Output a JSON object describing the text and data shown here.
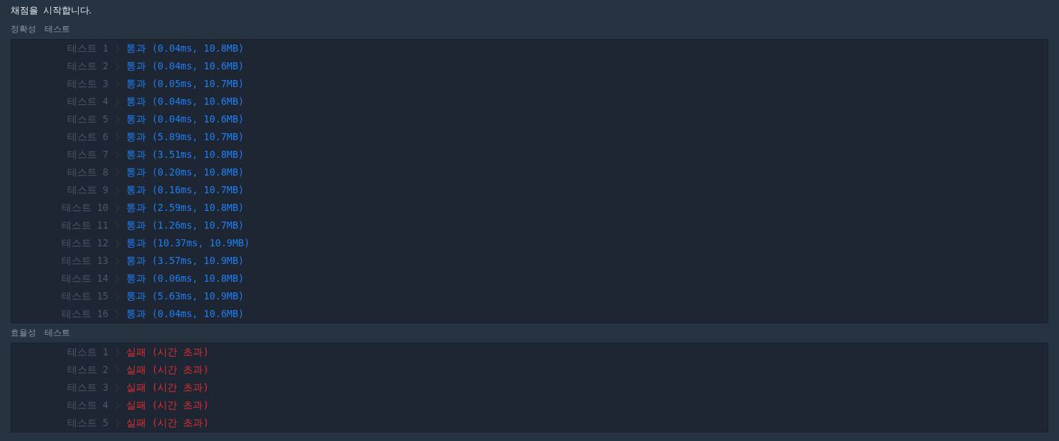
{
  "message": "채점을 시작합니다.",
  "sections": [
    {
      "title": "정확성 테스트",
      "rows": [
        {
          "label": "테스트 1",
          "kind": "pass",
          "result": "통과 (0.04ms, 10.8MB)"
        },
        {
          "label": "테스트 2",
          "kind": "pass",
          "result": "통과 (0.04ms, 10.6MB)"
        },
        {
          "label": "테스트 3",
          "kind": "pass",
          "result": "통과 (0.05ms, 10.7MB)"
        },
        {
          "label": "테스트 4",
          "kind": "pass",
          "result": "통과 (0.04ms, 10.6MB)"
        },
        {
          "label": "테스트 5",
          "kind": "pass",
          "result": "통과 (0.04ms, 10.6MB)"
        },
        {
          "label": "테스트 6",
          "kind": "pass",
          "result": "통과 (5.89ms, 10.7MB)"
        },
        {
          "label": "테스트 7",
          "kind": "pass",
          "result": "통과 (3.51ms, 10.8MB)"
        },
        {
          "label": "테스트 8",
          "kind": "pass",
          "result": "통과 (0.20ms, 10.8MB)"
        },
        {
          "label": "테스트 9",
          "kind": "pass",
          "result": "통과 (0.16ms, 10.7MB)"
        },
        {
          "label": "테스트 10",
          "kind": "pass",
          "result": "통과 (2.59ms, 10.8MB)"
        },
        {
          "label": "테스트 11",
          "kind": "pass",
          "result": "통과 (1.26ms, 10.7MB)"
        },
        {
          "label": "테스트 12",
          "kind": "pass",
          "result": "통과 (10.37ms, 10.9MB)"
        },
        {
          "label": "테스트 13",
          "kind": "pass",
          "result": "통과 (3.57ms, 10.9MB)"
        },
        {
          "label": "테스트 14",
          "kind": "pass",
          "result": "통과 (0.06ms, 10.8MB)"
        },
        {
          "label": "테스트 15",
          "kind": "pass",
          "result": "통과 (5.63ms, 10.9MB)"
        },
        {
          "label": "테스트 16",
          "kind": "pass",
          "result": "통과 (0.04ms, 10.6MB)"
        }
      ]
    },
    {
      "title": "효율성 테스트",
      "rows": [
        {
          "label": "테스트 1",
          "kind": "fail",
          "result": "실패 (시간 초과)"
        },
        {
          "label": "테스트 2",
          "kind": "fail",
          "result": "실패 (시간 초과)"
        },
        {
          "label": "테스트 3",
          "kind": "fail",
          "result": "실패 (시간 초과)"
        },
        {
          "label": "테스트 4",
          "kind": "fail",
          "result": "실패 (시간 초과)"
        },
        {
          "label": "테스트 5",
          "kind": "fail",
          "result": "실패 (시간 초과)"
        }
      ]
    }
  ]
}
